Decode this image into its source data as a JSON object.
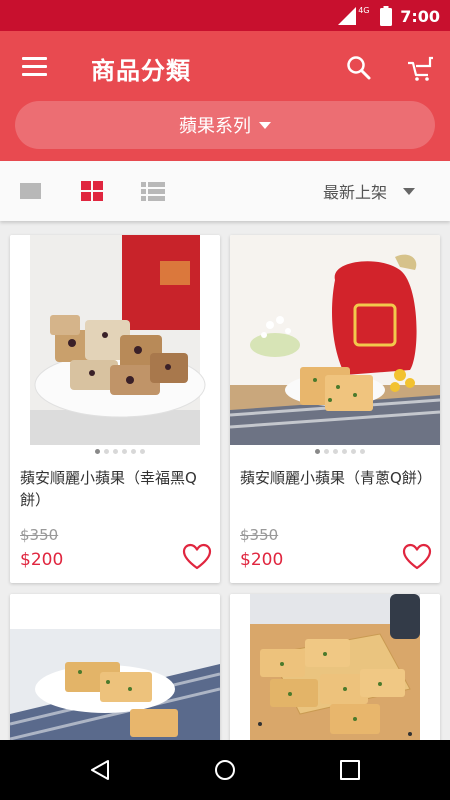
{
  "status_bar": {
    "time": "7:00",
    "network": "4G",
    "icons": [
      "signal-icon",
      "battery-icon"
    ]
  },
  "app_bar": {
    "title": "商品分類",
    "icons": [
      "menu-icon",
      "search-icon",
      "cart-icon"
    ],
    "category": {
      "selected": "蘋果系列",
      "icon": "caret-down-icon"
    }
  },
  "toolbar": {
    "view_modes": [
      {
        "icon": "single-view-icon",
        "active": false
      },
      {
        "icon": "grid-view-icon",
        "active": true
      },
      {
        "icon": "list-view-icon",
        "active": false
      }
    ],
    "sort": {
      "selected": "最新上架",
      "icon": "caret-down-icon"
    }
  },
  "products": [
    {
      "name": "蘋安順麗小蘋果（幸福黑Q餅）",
      "original_price": "$350",
      "sale_price": "$200",
      "image_icon": "product-photo-pastry-plate",
      "carousel_dots": 6,
      "carousel_active": 1
    },
    {
      "name": "蘋安順麗小蘋果（青蔥Q餅）",
      "original_price": "$350",
      "sale_price": "$200",
      "image_icon": "product-photo-gift-box-crackers",
      "carousel_dots": 6,
      "carousel_active": 1
    },
    {
      "name": "",
      "image_icon": "product-photo-cracker-plate"
    },
    {
      "name": "",
      "image_icon": "product-photo-stacked-crackers"
    }
  ],
  "nav_bar": {
    "icons": [
      "back-icon",
      "home-icon",
      "recents-icon"
    ]
  },
  "colors": {
    "status_bar": "#c8102e",
    "app_bar": "#e84a50",
    "accent": "#e0263f",
    "price": "#e0263f"
  }
}
